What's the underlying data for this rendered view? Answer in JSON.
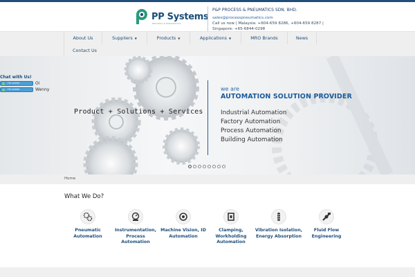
{
  "header": {
    "logo_text": "PP Systems",
    "logo_sub": "PROCESS & PNEUMATICS",
    "company_name": "P&P PROCESS & PNEUMATICS SDN. BHD.",
    "email": "sales@processpneumatics.com",
    "call_line": "Call us now | Malaysia: +604-659 8286, +604-659 8287 | Singapore: +65-6844-0298"
  },
  "nav": {
    "items": [
      {
        "label": "About Us",
        "has_dropdown": false
      },
      {
        "label": "Suppliers",
        "has_dropdown": true
      },
      {
        "label": "Products",
        "has_dropdown": true
      },
      {
        "label": "Applications",
        "has_dropdown": true
      },
      {
        "label": "MRO Brands",
        "has_dropdown": false
      },
      {
        "label": "News",
        "has_dropdown": false
      },
      {
        "label": "Contact Us",
        "has_dropdown": false
      }
    ],
    "caret": "▼"
  },
  "chat": {
    "title": "Chat with Us!",
    "agents": [
      {
        "status": "I'm online",
        "name": "Oi"
      },
      {
        "status": "I'm online",
        "name": "Wenny"
      }
    ]
  },
  "hero": {
    "tagline": "Product + Solutions + Services",
    "we_are": "we are",
    "provider": "AUTOMATION SOLUTION PROVIDER",
    "services": [
      "Industrial Automation",
      "Factory Automation",
      "Process Automation",
      "Building Automation"
    ],
    "slide_count": 8,
    "active_slide": 1
  },
  "breadcrumb": {
    "home": "Home"
  },
  "what_we_do": {
    "title": "What We Do?",
    "services": [
      {
        "label": "Pneumatic Automation",
        "icon": "pneumatic-icon"
      },
      {
        "label": "Instrumentation, Process Automation",
        "icon": "gauge-icon"
      },
      {
        "label": "Machine Vision, ID Automation",
        "icon": "camera-icon"
      },
      {
        "label": "Clamping, Workholding Automation",
        "icon": "clamp-icon"
      },
      {
        "label": "Vibration Isolation, Energy Absorption",
        "icon": "damper-icon"
      },
      {
        "label": "Fluid Flow Engineering",
        "icon": "valve-icon"
      }
    ]
  },
  "colors": {
    "brand": "#1f4e79",
    "accent": "#2a6aa8",
    "logo_green": "#2a9a7a"
  }
}
